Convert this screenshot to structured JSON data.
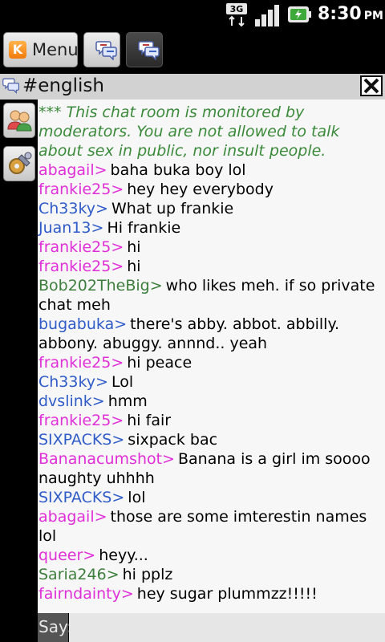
{
  "status_bar": {
    "network": "3G",
    "time": "8:30",
    "ampm": "PM"
  },
  "toolbar": {
    "menu_label": "Menu",
    "logo_letter": "K"
  },
  "channel": {
    "title": "#english"
  },
  "system_message": "*** This chat room is monitored by moderators. You are not allowed to talk about sex in public, nor insult people.",
  "messages": [
    {
      "nick": "abagail>",
      "text": "baha buka boy lol",
      "color": "#e02ed8"
    },
    {
      "nick": "frankie25>",
      "text": "hey hey everybody",
      "color": "#e02ed8"
    },
    {
      "nick": "Ch33ky>",
      "text": "What up frankie",
      "color": "#2f5cc8"
    },
    {
      "nick": "Juan13>",
      "text": "Hi frankie",
      "color": "#2f5cc8"
    },
    {
      "nick": "frankie25>",
      "text": "hi",
      "color": "#e02ed8"
    },
    {
      "nick": "frankie25>",
      "text": "hi",
      "color": "#e02ed8"
    },
    {
      "nick": "Bob202TheBig>",
      "text": "who likes meh. if so private chat meh",
      "color": "#3d7e3d"
    },
    {
      "nick": "bugabuka>",
      "text": "there's abby. abbot. abbilly. abbony. abuggy. annnd.. yeah",
      "color": "#2f5cc8"
    },
    {
      "nick": "frankie25>",
      "text": "hi peace",
      "color": "#e02ed8"
    },
    {
      "nick": "Ch33ky>",
      "text": "Lol",
      "color": "#2f5cc8"
    },
    {
      "nick": "dvslink>",
      "text": "hmm",
      "color": "#2f5cc8"
    },
    {
      "nick": "frankie25>",
      "text": "hi fair",
      "color": "#e02ed8"
    },
    {
      "nick": "SIXPACKS>",
      "text": "sixpack bac",
      "color": "#2f5cc8"
    },
    {
      "nick": "Bananacumshot>",
      "text": "Banana is a girl im soooo naughty uhhhh",
      "color": "#e02ed8"
    },
    {
      "nick": "SIXPACKS>",
      "text": "lol",
      "color": "#2f5cc8"
    },
    {
      "nick": "abagail>",
      "text": "those are some imterestin names lol",
      "color": "#e02ed8"
    },
    {
      "nick": "queer>",
      "text": "heyy...",
      "color": "#e02ed8"
    },
    {
      "nick": "Saria246>",
      "text": "hi pplz",
      "color": "#3d7e3d"
    },
    {
      "nick": "fairndainty>",
      "text": "hey sugar plummzz!!!!!",
      "color": "#e02ed8"
    }
  ],
  "say_bar": {
    "label": "Say:",
    "value": "",
    "placeholder": ""
  },
  "icons": {
    "network": "3g-icon",
    "signal": "signal-bars-icon",
    "battery": "battery-charging-icon",
    "app_logo": "k-logo-icon",
    "chat_tab": "chat-bubbles-icon",
    "users": "users-icon",
    "settings": "wrench-gear-icon",
    "close": "close-icon"
  }
}
